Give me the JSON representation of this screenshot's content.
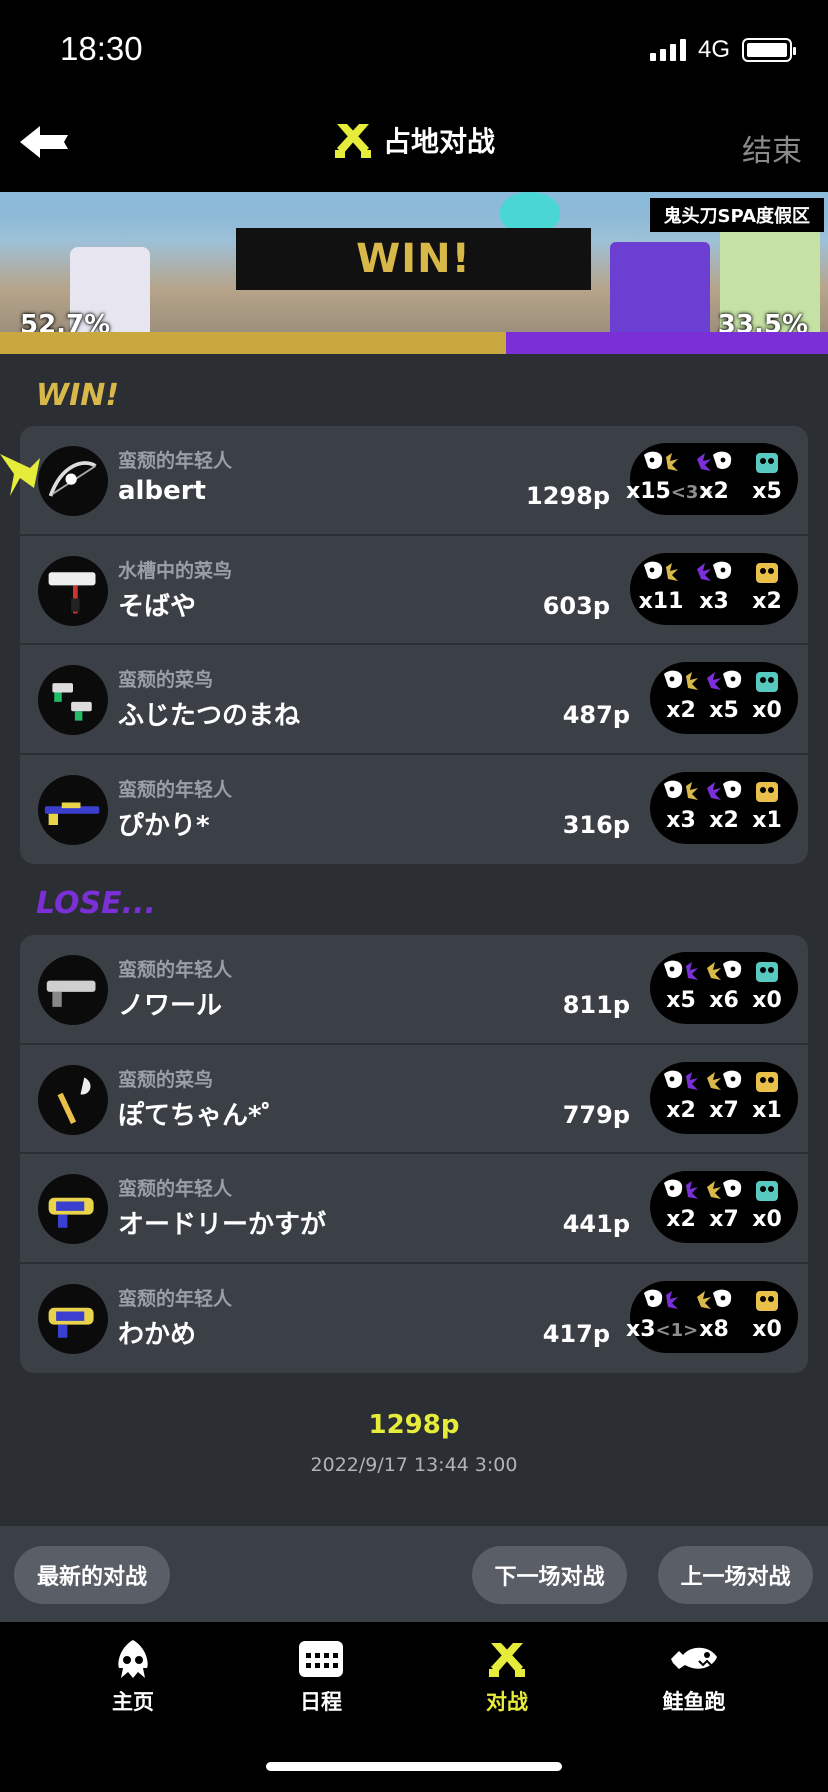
{
  "status": {
    "time": "18:30",
    "network": "4G"
  },
  "nav": {
    "title": "占地对战",
    "end_label": "结束"
  },
  "banner": {
    "result": "WIN!",
    "stage": "鬼头刀SPA度假区",
    "win_percent": "52.7%",
    "lose_percent": "33.5%",
    "win_ratio": 0.611
  },
  "win_team": {
    "label": "WIN!",
    "players": [
      {
        "title": "蛮颓的年轻人",
        "name": "albert",
        "points": "1298p",
        "weapon_icon": "bow-weapon-icon",
        "kills": "x15",
        "assists": "<3>",
        "deaths": "x2",
        "specials": "x5"
      },
      {
        "title": "水槽中的菜鸟",
        "name": "そばや",
        "points": "603p",
        "weapon_icon": "roller-weapon-icon",
        "kills": "x11",
        "assists": "",
        "deaths": "x3",
        "specials": "x2"
      },
      {
        "title": "蛮颓的菜鸟",
        "name": "ふじたつのまね",
        "points": "487p",
        "weapon_icon": "dualies-weapon-icon",
        "kills": "x2",
        "assists": "",
        "deaths": "x5",
        "specials": "x0"
      },
      {
        "title": "蛮颓的年轻人",
        "name": "ぴかり*",
        "points": "316p",
        "weapon_icon": "charger-weapon-icon",
        "kills": "x3",
        "assists": "",
        "deaths": "x2",
        "specials": "x1"
      }
    ]
  },
  "lose_team": {
    "label": "LOSE...",
    "players": [
      {
        "title": "蛮颓的年轻人",
        "name": "ノワール",
        "points": "811p",
        "weapon_icon": "shooter-weapon-icon",
        "kills": "x5",
        "assists": "",
        "deaths": "x6",
        "specials": "x0"
      },
      {
        "title": "蛮颓的菜鸟",
        "name": "ぽてちゃん*゜",
        "points": "779p",
        "weapon_icon": "brush-weapon-icon",
        "kills": "x2",
        "assists": "",
        "deaths": "x7",
        "specials": "x1"
      },
      {
        "title": "蛮颓的年轻人",
        "name": "オードリーかすが",
        "points": "441p",
        "weapon_icon": "blaster-weapon-icon",
        "kills": "x2",
        "assists": "",
        "deaths": "x7",
        "specials": "x0"
      },
      {
        "title": "蛮颓的年轻人",
        "name": "わかめ",
        "points": "417p",
        "weapon_icon": "blaster-weapon-icon",
        "kills": "x3",
        "assists": "<1>",
        "deaths": "x8",
        "specials": "x0"
      }
    ]
  },
  "summary": {
    "points": "1298p",
    "datetime": "2022/9/17 13:44 3:00"
  },
  "actions": {
    "latest": "最新的对战",
    "next": "下一场对战",
    "prev": "上一场对战"
  },
  "tabs": [
    {
      "label": "主页",
      "icon": "squid-home-icon"
    },
    {
      "label": "日程",
      "icon": "calendar-icon"
    },
    {
      "label": "对战",
      "icon": "battle-icon"
    },
    {
      "label": "鲑鱼跑",
      "icon": "salmon-icon"
    }
  ],
  "colors": {
    "win": "#d9b84a",
    "lose": "#7b2fd6",
    "accent": "#e6ec3a",
    "panel": "#3b3f46",
    "bg": "#2b2e33"
  }
}
